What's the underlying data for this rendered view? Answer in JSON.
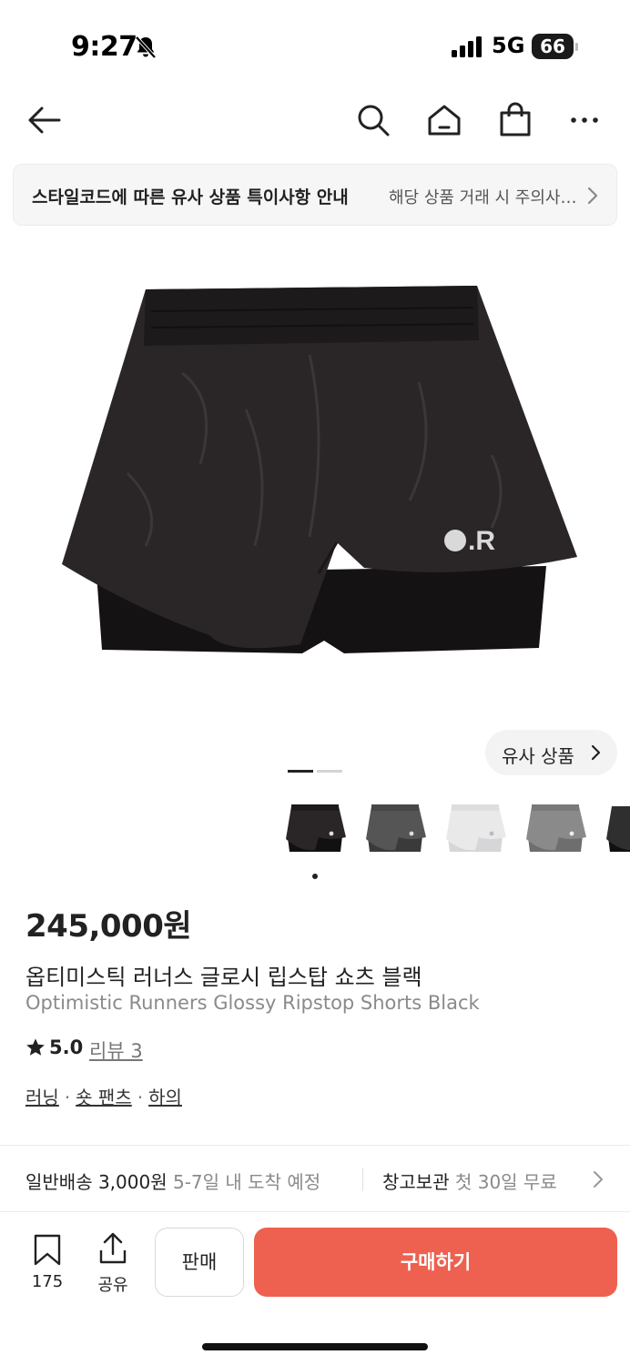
{
  "status_bar": {
    "time": "9:27",
    "network": "5G",
    "battery": "66",
    "icons": [
      "bell-slash-icon",
      "signal-icon"
    ]
  },
  "top_nav": {
    "icons": [
      "back-arrow-icon",
      "search-icon",
      "home-icon",
      "shopping-bag-icon",
      "more-icon"
    ]
  },
  "notice": {
    "title": "스타일코드에 따른 유사 상품 특이사항 안내",
    "description": "해당 상품 거래 시 주의사항을 확인해주세요",
    "icon": "chevron-right-icon"
  },
  "gallery": {
    "logo_text": ".R",
    "similar_label": "유사 상품",
    "colors": {
      "black": "#2a2627",
      "charcoal": "#555555",
      "white": "#e9e9ea",
      "gray": "#8a8a8a"
    }
  },
  "product": {
    "price": "245,000원",
    "name_ko": "옵티미스틱 러너스 글로시 립스탑 쇼츠 블랙",
    "name_en": "Optimistic Runners Glossy Ripstop Shorts Black",
    "rating": "5.0",
    "review_label": "리뷰 3",
    "categories": [
      "러닝",
      "숏 팬츠",
      "하의"
    ]
  },
  "shipping": {
    "label": "일반배송 3,000원",
    "note": "5-7일 내 도착 예정",
    "store_label": "창고보관",
    "store_note": "첫 30일 무료"
  },
  "bottom_bar": {
    "wish_count": "175",
    "share_label": "공유",
    "sell_label": "판매",
    "buy_label": "구매하기",
    "accent": "#ee604f"
  }
}
